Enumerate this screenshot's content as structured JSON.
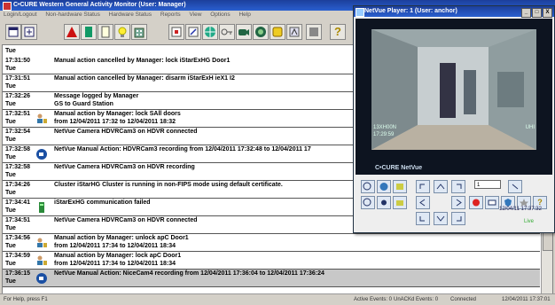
{
  "app": {
    "title": "C•CURE Western General Activity Monitor (User: Manager)",
    "menu": [
      "Login/Logout",
      "Non-hardware Status",
      "Hardware Status",
      "Reports",
      "View",
      "Options",
      "Help"
    ]
  },
  "toolbar": {
    "icons": [
      "window-icon",
      "pin-icon",
      "alarm-triangle-icon",
      "door-icon",
      "document-icon",
      "lightbulb-icon",
      "building-icon",
      "image-icon",
      "edit-icon",
      "globe-icon",
      "key-icon",
      "camera-icon",
      "record-icon",
      "badge-icon",
      "network-icon",
      "disk-icon",
      "help-icon"
    ],
    "help_label": "?"
  },
  "log": {
    "top_day": "Tue",
    "rows": [
      {
        "time": "17:31:50",
        "day": "Tue",
        "msg": "Manual action cancelled by Manager: lock iStarExHG Door1",
        "msg2": "",
        "icon": "",
        "hl": false
      },
      {
        "time": "17:31:51",
        "day": "Tue",
        "msg": "Manual action cancelled by Manager: disarm iStarExH ieX1 I2",
        "msg2": "",
        "icon": "",
        "hl": false
      },
      {
        "time": "17:32:26",
        "day": "Tue",
        "msg": "Message logged by Manager",
        "msg2": "GS to Guard Station",
        "icon": "",
        "hl": false
      },
      {
        "time": "17:32:51",
        "day": "Tue",
        "msg": "Manual action by Manager: lock SAll doors",
        "msg2": "from 12/04/2011 17:32  to  12/04/2011 18:32",
        "icon": "person-lock-icon",
        "hl": false
      },
      {
        "time": "17:32:54",
        "day": "Tue",
        "msg": "NetVue Camera HDVRCam3 on HDVR connected",
        "msg2": "",
        "icon": "",
        "hl": false
      },
      {
        "time": "17:32:58",
        "day": "Tue",
        "msg": "NetVue Manual Action: HDVRCam3 recording from 12/04/2011 17:32:48  to  12/04/2011 17",
        "msg2": "",
        "icon": "camera-record-icon",
        "hl": false
      },
      {
        "time": "17:32:58",
        "day": "Tue",
        "msg": "NetVue Camera HDVRCam3 on HDVR recording",
        "msg2": "",
        "icon": "",
        "hl": false
      },
      {
        "time": "17:34:26",
        "day": "Tue",
        "msg": "Cluster iStarHG Cluster is running in non-FIPS mode using default certificate.",
        "msg2": "",
        "icon": "",
        "hl": false
      },
      {
        "time": "17:34:41",
        "day": "Tue",
        "msg": "iStarExHG communication failed",
        "msg2": "",
        "icon": "panel-icon",
        "hl": false
      },
      {
        "time": "17:34:51",
        "day": "Tue",
        "msg": "NetVue Camera HDVRCam3 on HDVR connected",
        "msg2": "",
        "icon": "",
        "hl": false
      },
      {
        "time": "17:34:56",
        "day": "Tue",
        "msg": "Manual action by Manager: unlock apC Door1",
        "msg2": "from 12/04/2011 17:34  to  12/04/2011 18:34",
        "icon": "person-lock-icon",
        "hl": false
      },
      {
        "time": "17:34:59",
        "day": "Tue",
        "msg": "Manual action by Manager: lock apC Door1",
        "msg2": "from 12/04/2011 17:34  to  12/04/2011 18:34",
        "icon": "person-lock-icon",
        "hl": false
      },
      {
        "time": "17:36:15",
        "day": "Tue",
        "msg": "NetVue Manual Action: NiceCam4 recording from 12/04/2011 17:36:04  to  12/04/2011 17:36:24",
        "msg2": "",
        "icon": "camera-record-icon",
        "hl": true
      }
    ]
  },
  "status": {
    "help": "For Help, press F1",
    "active_events": "Active Events: 0",
    "unacked": "UnACKd Events: 0",
    "connection": "Connected",
    "datetime": "12/04/2011 17:37:01"
  },
  "player": {
    "title": "NetVue Player: 1 (User: anchor)",
    "min_label": "_",
    "max_label": "□",
    "close_label": "X",
    "cam_label": "13XH00N",
    "cam_time": "17:29:59",
    "cam_right": "UHI",
    "brand": "C•CURE NetVue",
    "spinner": "1",
    "date": "12/04/11 17:37:32",
    "live": "Live"
  },
  "colors": {
    "title_bar": "#2a5fcf",
    "highlight_row": "#c8c8c8",
    "video_bg": "#0d1420"
  }
}
